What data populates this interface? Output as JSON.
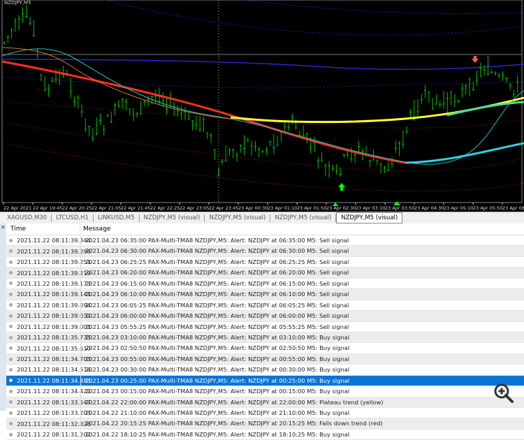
{
  "chart": {
    "symbol": "NZDJPY,M5",
    "x_labels": [
      "22 Apr 2021",
      "22 Apr 19:45",
      "22 Apr 20:25",
      "22 Apr 21:05",
      "22 Apr 21:45",
      "22 Apr 22:25",
      "22 Apr 23:05",
      "22 Apr 23:45",
      "23 Apr 00:30",
      "23 Apr 01:10",
      "23 Apr 01:50",
      "23 Apr 02:30",
      "23 Apr 03:10",
      "23 Apr 03:50",
      "23 Apr 04:30",
      "23 Apr 05:10",
      "23 Apr 05:50",
      "23 Apr 06:"
    ],
    "price_series": [
      60,
      45,
      35,
      25,
      40,
      110,
      130,
      115,
      100,
      125,
      150,
      175,
      190,
      180,
      175,
      160,
      150,
      158,
      160,
      150,
      140,
      135,
      145,
      155,
      165,
      170,
      175,
      178,
      200,
      250,
      225,
      215,
      210,
      205,
      208,
      215,
      205,
      200,
      185,
      175,
      190,
      200,
      215,
      235,
      245,
      250,
      230,
      220,
      215,
      222,
      230,
      238,
      240,
      215,
      200,
      170,
      150,
      140,
      145,
      150,
      145,
      140,
      132,
      125,
      110,
      95,
      105,
      115,
      120,
      125
    ],
    "colors": {
      "candle": "#00c000",
      "ma_red": "#ff3020",
      "ma_yellow": "#ffff30",
      "cyan": "#20d0d0",
      "blue": "#2020c0",
      "buy_arrow": "#00ff00",
      "sell_arrow": "#ff6060"
    }
  },
  "tabs": [
    "XAGUSD,M30",
    "LTCUSD,H1",
    "LINKUSD,M5",
    "NZDJPY,M5 (visual)",
    "NZDJPY,M5 (visual)",
    "NZDJPY,M5 (visual)",
    "NZDJPY,M5 (visual)"
  ],
  "active_tab": 6,
  "journal": {
    "columns": {
      "time": "Time",
      "message": "Message"
    },
    "selected_index": 13,
    "rows": [
      {
        "time": "2021.11.22 08:11:39.344",
        "message": "2021.04.23 06:35:00  PAX-Multi-TMA8 NZDJPY,M5: Alert: NZDJPY at 06:35:00 M5: Sell signal"
      },
      {
        "time": "2021.11.22 08:11:39.298",
        "message": "2021.04.23 06:30:00  PAX-Multi-TMA8 NZDJPY,M5: Alert: NZDJPY at 06:30:00 M5: Sell signal"
      },
      {
        "time": "2021.11.22 08:11:39.251",
        "message": "2021.04.23 06:25:25  PAX-Multi-TMA8 NZDJPY,M5: Alert: NZDJPY at 06:25:25 M5: Sell signal"
      },
      {
        "time": "2021.11.22 08:11:39.219",
        "message": "2021.04.23 06:20:00  PAX-Multi-TMA8 NZDJPY,M5: Alert: NZDJPY at 06:20:00 M5: Sell signal"
      },
      {
        "time": "2021.11.22 08:11:39.173",
        "message": "2021.04.23 06:15:00  PAX-Multi-TMA8 NZDJPY,M5: Alert: NZDJPY at 06:15:00 M5: Sell signal"
      },
      {
        "time": "2021.11.22 08:11:39.141",
        "message": "2021.04.23 06:10:00  PAX-Multi-TMA8 NZDJPY,M5: Alert: NZDJPY at 06:10:00 M5: Sell signal"
      },
      {
        "time": "2021.11.22 08:11:39.094",
        "message": "2021.04.23 06:05:25  PAX-Multi-TMA8 NZDJPY,M5: Alert: NZDJPY at 06:05:25 M5: Sell signal"
      },
      {
        "time": "2021.11.22 08:11:39.032",
        "message": "2021.04.23 06:00:00  PAX-Multi-TMA8 NZDJPY,M5: Alert: NZDJPY at 06:00:00 M5: Sell signal"
      },
      {
        "time": "2021.11.22 08:11:39.001",
        "message": "2021.04.23 05:55:25  PAX-Multi-TMA8 NZDJPY,M5: Alert: NZDJPY at 05:55:25 M5: Sell signal"
      },
      {
        "time": "2021.11.22 08:11:35.735",
        "message": "2021.04.23 03:10:00  PAX-Multi-TMA8 NZDJPY,M5: Alert: NZDJPY at 03:10:00 M5: Buy signal"
      },
      {
        "time": "2021.11.22 08:11:35.610",
        "message": "2021.04.23 02:50:50  PAX-Multi-TMA8 NZDJPY,M5: Alert: NZDJPY at 02:50:50 M5: Buy signal"
      },
      {
        "time": "2021.11.22 08:11:34.703",
        "message": "2021.04.23 00:55:00  PAX-Multi-TMA8 NZDJPY,M5: Alert: NZDJPY at 00:55:00 M5: Buy signal"
      },
      {
        "time": "2021.11.22 08:11:34.516",
        "message": "2021.04.23 00:30:00  PAX-Multi-TMA8 NZDJPY,M5: Alert: NZDJPY at 00:30:00 M5: Buy signal"
      },
      {
        "time": "2021.11.22 08:11:34.485",
        "message": "2021.04.23 00:25:00  PAX-Multi-TMA8 NZDJPY,M5: Alert: NZDJPY at 00:25:00 M5: Buy signal"
      },
      {
        "time": "2021.11.22 08:11:34.422",
        "message": "2021.04.23 00:15:00  PAX-Multi-TMA8 NZDJPY,M5: Alert: NZDJPY at 00:15:00 M5: Buy signal"
      },
      {
        "time": "2021.11.22 08:11:33.547",
        "message": "2021.04.22 22:00:00  PAX-Multi-TMA8 NZDJPY,M5: Alert: NZDJPY at 22:00:00 M5: Plateau trend (yellow)"
      },
      {
        "time": "2021.11.22 08:11:33.203",
        "message": "2021.04.22 21:10:00  PAX-Multi-TMA8 NZDJPY,M5: Alert: NZDJPY at 21:10:00 M5: Buy signal"
      },
      {
        "time": "2021.11.22 08:11:32.828",
        "message": "2021.04.22 20:15:25  PAX-Multi-TMA8 NZDJPY,M5: Alert: NZDJPY at 20:15:25 M5: Falls down trend (red)"
      },
      {
        "time": "2021.11.22 08:11:31.202",
        "message": "2021.04.22 18:10:25  PAX-Multi-TMA8 NZDJPY,M5: Alert: NZDJPY at 18:10:25 M5: Buy signal"
      }
    ]
  }
}
